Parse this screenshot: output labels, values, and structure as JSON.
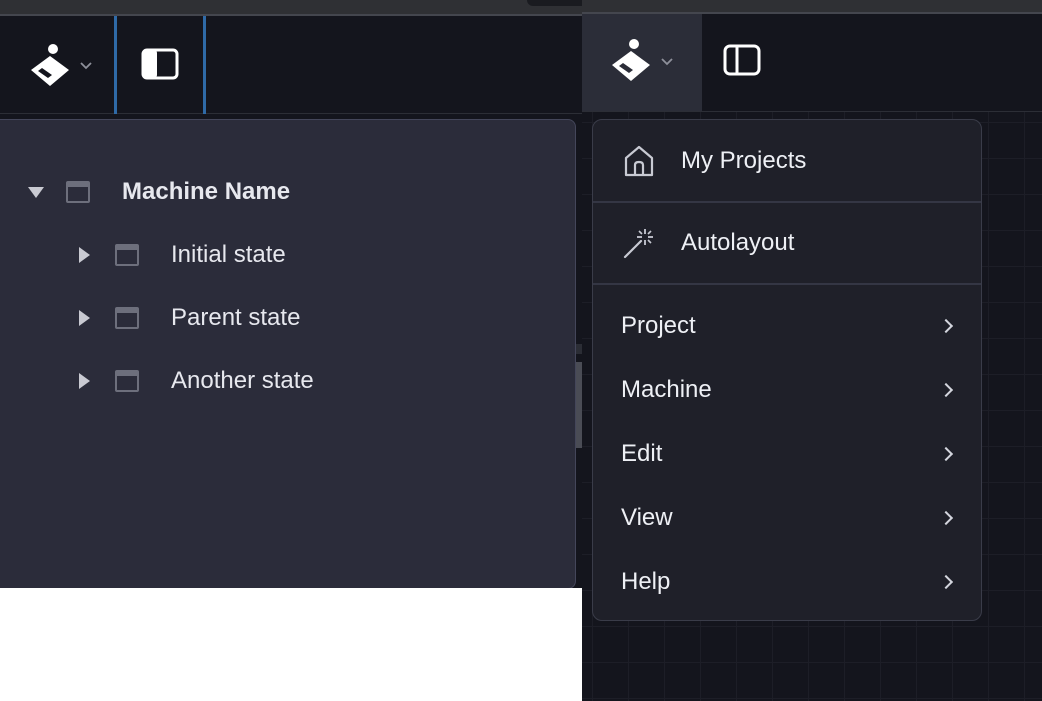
{
  "left": {
    "tree": {
      "root": {
        "label": "Machine Name",
        "expanded": true
      },
      "children": [
        {
          "label": "Initial state",
          "expanded": false
        },
        {
          "label": "Parent state",
          "expanded": false
        },
        {
          "label": "Another state",
          "expanded": false
        }
      ]
    },
    "icons": {
      "logo": "app-logo-icon",
      "logo_dropdown": "chevron-down-icon",
      "sidebar_toggle": "sidebar-toggle-icon-active"
    },
    "accent_focus_color": "#2f6aa7"
  },
  "right": {
    "icons": {
      "logo": "app-logo-icon",
      "logo_dropdown": "chevron-down-icon",
      "sidebar_toggle": "sidebar-toggle-icon"
    },
    "menu": {
      "items": [
        {
          "label": "My Projects",
          "icon": "home-icon",
          "submenu": false
        },
        {
          "label": "Autolayout",
          "icon": "magic-wand-icon",
          "submenu": false
        },
        {
          "label": "Project",
          "submenu": true
        },
        {
          "label": "Machine",
          "submenu": true
        },
        {
          "label": "Edit",
          "submenu": true
        },
        {
          "label": "View",
          "submenu": true
        },
        {
          "label": "Help",
          "submenu": true
        }
      ]
    }
  },
  "colors": {
    "background_dark": "#14151d",
    "panel": "#2b2c3a",
    "menu_bg": "#1f2029",
    "text": "#eef0f5"
  }
}
